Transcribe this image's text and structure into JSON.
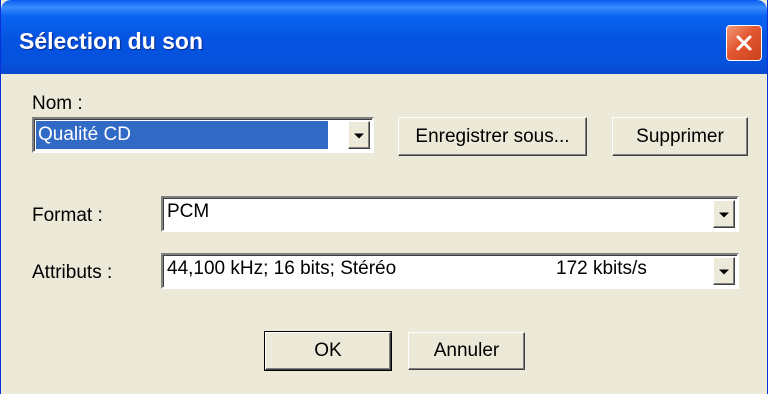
{
  "dialog": {
    "title": "Sélection du son",
    "close_icon": "close-icon"
  },
  "name": {
    "label": "Nom :",
    "value": "Qualité CD"
  },
  "buttons": {
    "save_as": "Enregistrer sous...",
    "delete": "Supprimer",
    "ok": "OK",
    "cancel": "Annuler"
  },
  "format": {
    "label": "Format :",
    "value": "PCM"
  },
  "attributes": {
    "label": "Attributs :",
    "value": "44,100 kHz; 16 bits; Stéréo",
    "rate": "172 kbits/s"
  },
  "colors": {
    "titlebar": "#0553e0",
    "selection": "#316ac5",
    "close_button": "#e2572f",
    "dialog_background": "#ece9d8"
  }
}
